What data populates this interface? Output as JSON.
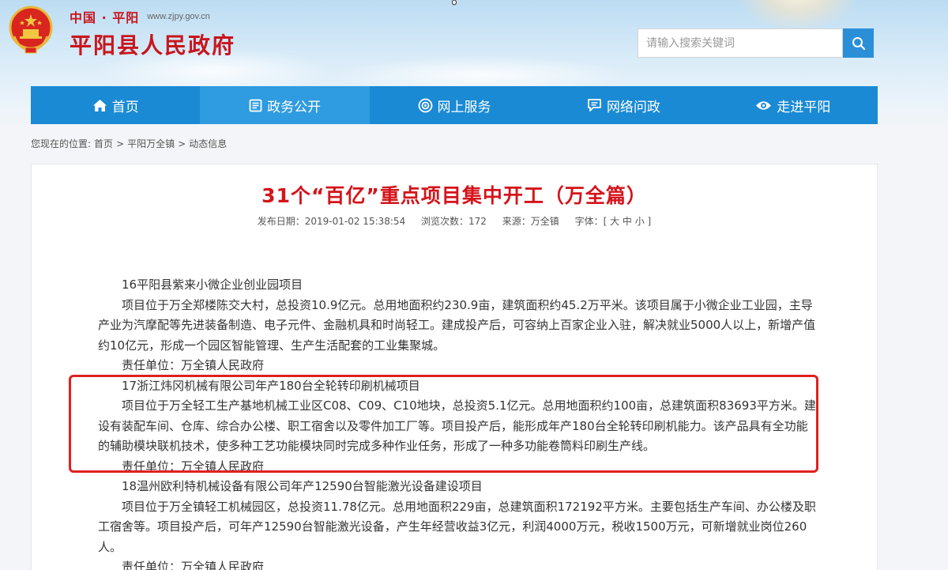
{
  "header": {
    "small_name": "中国 · 平阳",
    "domain": "www.zjpy.gov.cn",
    "title": "平阳县人民政府",
    "search_placeholder": "请输入搜索关键词"
  },
  "nav": {
    "items": [
      {
        "label": "首页",
        "icon": "home-icon"
      },
      {
        "label": "政务公开",
        "icon": "document-icon"
      },
      {
        "label": "网上服务",
        "icon": "service-icon"
      },
      {
        "label": "网络问政",
        "icon": "chat-icon"
      },
      {
        "label": "走进平阳",
        "icon": "eye-icon"
      }
    ]
  },
  "breadcrumb": {
    "prefix": "您现在的位置:",
    "items": [
      "首页",
      "平阳万全镇",
      "动态信息"
    ],
    "separator": ">"
  },
  "article": {
    "title": "31个“百亿”重点项目集中开工（万全篇）",
    "publish_date": "发布日期：2019-01-02 15:38:54",
    "views": "浏览次数：172",
    "source": "来源：万全镇",
    "font_size_label": "字体：[ 大 中 小 ]",
    "paragraphs": [
      "16平阳县紫来小微企业创业园项目",
      "项目位于万全郑楼陈交大村，总投资10.9亿元。总用地面积约230.9亩，建筑面积约45.2万平米。该项目属于小微企业工业园，主导产业为汽摩配等先进装备制造、电子元件、金融机具和时尚轻工。建成投产后，可容纳上百家企业入驻，解决就业5000人以上，新增产值约10亿元，形成一个园区智能管理、生产生活配套的工业集聚城。",
      "责任单位：万全镇人民政府",
      "17浙江炜冈机械有限公司年产180台全轮转印刷机械项目",
      "项目位于万全轻工生产基地机械工业区C08、C09、C10地块，总投资5.1亿元。总用地面积约100亩，总建筑面积83693平方米。建设有装配车间、仓库、综合办公楼、职工宿舍以及零件加工厂等。项目投产后，能形成年产180台全轮转印刷机能力。该产品具有全功能的辅助模块联机技术，使多种工艺功能模块同时完成多种作业任务，形成了一种多功能卷筒料印刷生产线。",
      "责任单位：万全镇人民政府",
      "18温州欧利特机械设备有限公司年产12590台智能激光设备建设项目",
      "项目位于万全镇轻工机械园区，总投资11.78亿元。总用地面积229亩，总建筑面积172192平方米。主要包括生产车间、办公楼及职工宿舍等。项目投产后，可年产12590台智能激光设备，产生年经营收益3亿元，利润4000万元，税收1500万元，可新增就业岗位260人。",
      "责任单位：万全镇人民政府"
    ]
  },
  "colors": {
    "brand_red": "#c8161d",
    "nav_blue": "#1a8ad4",
    "highlight_red": "#e02020"
  }
}
